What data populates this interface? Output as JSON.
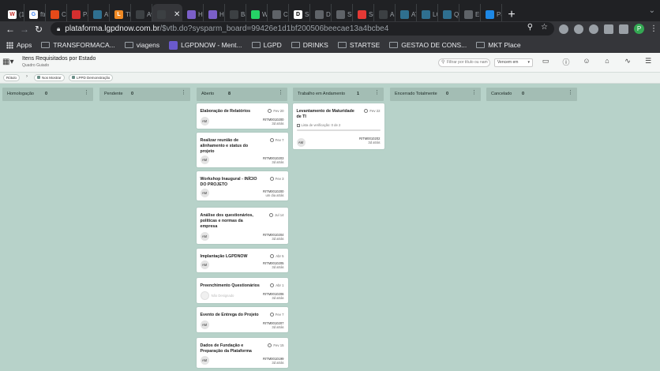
{
  "browser": {
    "tabs": [
      {
        "label": "(10",
        "icon": "w-icon",
        "color": "#ffffff",
        "glyph": "W",
        "fg": "#c4302b"
      },
      {
        "label": "ftr",
        "icon": "google-icon",
        "color": "#ffffff",
        "glyph": "G",
        "fg": "#4285f4"
      },
      {
        "label": "Co",
        "icon": "app-icon",
        "color": "#e64a19",
        "glyph": "",
        "fg": "#ffffff"
      },
      {
        "label": "Pa",
        "icon": "app-icon",
        "color": "#d32f2f",
        "glyph": "",
        "fg": "#ffffff"
      },
      {
        "label": "Ata",
        "icon": "app-icon",
        "color": "#2f6f8f",
        "glyph": "",
        "fg": "#ffffff"
      },
      {
        "label": "The",
        "icon": "l-icon",
        "color": "#f08a24",
        "glyph": "L",
        "fg": "#ffffff"
      },
      {
        "label": "Ava",
        "icon": "app-icon",
        "color": "#3c4043",
        "glyph": "",
        "fg": "#ffffff"
      },
      {
        "label": "",
        "icon": "app-icon",
        "color": "#3c4043",
        "glyph": "",
        "fg": "#ffffff"
      },
      {
        "label": "Ha",
        "icon": "app-icon",
        "color": "#7b5fc9",
        "glyph": "",
        "fg": "#ffffff"
      },
      {
        "label": "Ha",
        "icon": "app-icon",
        "color": "#7b5fc9",
        "glyph": "",
        "fg": "#ffffff"
      },
      {
        "label": "Ba",
        "icon": "app-icon",
        "color": "#3c4043",
        "glyph": "",
        "fg": "#ffffff"
      },
      {
        "label": "Wh",
        "icon": "whatsapp-icon",
        "color": "#25d366",
        "glyph": "",
        "fg": "#ffffff"
      },
      {
        "label": "Cro",
        "icon": "app-icon",
        "color": "#5f6368",
        "glyph": "",
        "fg": "#ffffff"
      },
      {
        "label": "Se",
        "icon": "d-icon",
        "color": "#ffffff",
        "glyph": "D",
        "fg": "#000000"
      },
      {
        "label": "Dri",
        "icon": "app-icon",
        "color": "#5f6368",
        "glyph": "",
        "fg": "#ffffff"
      },
      {
        "label": "Se",
        "icon": "app-icon",
        "color": "#5f6368",
        "glyph": "",
        "fg": "#ffffff"
      },
      {
        "label": "Seg",
        "icon": "app-icon",
        "color": "#e53935",
        "glyph": "",
        "fg": "#ffffff"
      },
      {
        "label": "ASI",
        "icon": "app-icon",
        "color": "#3c4043",
        "glyph": "",
        "fg": "#ffffff"
      },
      {
        "label": "ATI",
        "icon": "app-icon",
        "color": "#2f6f8f",
        "glyph": "",
        "fg": "#ffffff"
      },
      {
        "label": "LGI",
        "icon": "app-icon",
        "color": "#2f6f8f",
        "glyph": "",
        "fg": "#ffffff"
      },
      {
        "label": "Qu",
        "icon": "app-icon",
        "color": "#2f6f8f",
        "glyph": "",
        "fg": "#ffffff"
      },
      {
        "label": "Err",
        "icon": "app-icon",
        "color": "#5f6368",
        "glyph": "",
        "fg": "#ffffff"
      },
      {
        "label": "Pa",
        "icon": "app-icon",
        "color": "#1e88e5",
        "glyph": "",
        "fg": "#ffffff"
      }
    ],
    "active_tab": 7,
    "url_host": "plataforma.lgpdnow.com.br",
    "url_path": "/$vtb.do?sysparm_board=99426e1d1bf200506beecae13a4bcbe4",
    "profile_initial": "P"
  },
  "bookmarks": [
    "Apps",
    "TRANSFORMACA...",
    "viagens",
    "LGPDNOW - Ment...",
    "LGPD",
    "DRINKS",
    "STARTSE",
    "GESTAO DE CONS...",
    "MKT Place"
  ],
  "header": {
    "title": "Itens Requisitados por Estado",
    "subtitle": "Quadro Guiado",
    "filter_placeholder": "Filtrar por título ou nam",
    "sort_label": "Vencem em"
  },
  "chips": [
    "Rótulo",
    "Nos Mostrar",
    "LPPD Demonstração"
  ],
  "lanes": [
    {
      "title": "Homologação",
      "count": "0"
    },
    {
      "title": "Pendente",
      "count": "0"
    },
    {
      "title": "Aberto",
      "count": "8"
    },
    {
      "title": "Trabalho em Andamento",
      "count": "1"
    },
    {
      "title": "Encerrado Totalmente",
      "count": "0"
    },
    {
      "title": "Cancelado",
      "count": "0"
    }
  ],
  "cards": [
    {
      "lane": 2,
      "title": "Elaboração de Relatórios",
      "date": "Fev 20",
      "avatar": "AM",
      "number": "RITM0010200",
      "ago": "3d atrás"
    },
    {
      "lane": 2,
      "title": "Realizar reunião de alinhamento e status do projeto",
      "date": "Fev 7",
      "avatar": "AM",
      "number": "RITM0010203",
      "ago": "3d atrás"
    },
    {
      "lane": 2,
      "title": "Workshop Inaugural - INÍCIO DO PROJETO",
      "date": "Fev 3",
      "avatar": "AM",
      "number": "RITM0010200",
      "ago": "um dia atrás"
    },
    {
      "lane": 2,
      "title": "Análise dos questionários, políticas e normas da empresa",
      "date": "Jul 14",
      "avatar": "AM",
      "number": "RITM0010204",
      "ago": "3d atrás"
    },
    {
      "lane": 2,
      "title": "Implantação LGPDNOW",
      "date": "Abr 5",
      "avatar": "AM",
      "number": "RITM0010205",
      "ago": "3d atrás"
    },
    {
      "lane": 2,
      "title": "Preenchimento Questionários",
      "date": "Abr 1",
      "avatar": "",
      "unassigned": "Não Designado",
      "number": "RITM0010206",
      "ago": "3d atrás"
    },
    {
      "lane": 2,
      "title": "Evento de Entrega do Projeto",
      "date": "Fev 7",
      "avatar": "AM",
      "number": "RITM0010207",
      "ago": "3d atrás"
    },
    {
      "lane": 2,
      "title": "Dados de Fundação e Preparação da Plataforma",
      "date": "Fev 15",
      "avatar": "AM",
      "number": "RITM0010199",
      "ago": "3d atrás"
    },
    {
      "lane": 3,
      "title": "Levantamento de Maturidade de TI",
      "date": "Fev 22",
      "avatar": "AM",
      "number": "RITM0010202",
      "ago": "3d atrás",
      "checklist": "Lista de verificação: 0 de 2",
      "progress": 0.0
    }
  ]
}
